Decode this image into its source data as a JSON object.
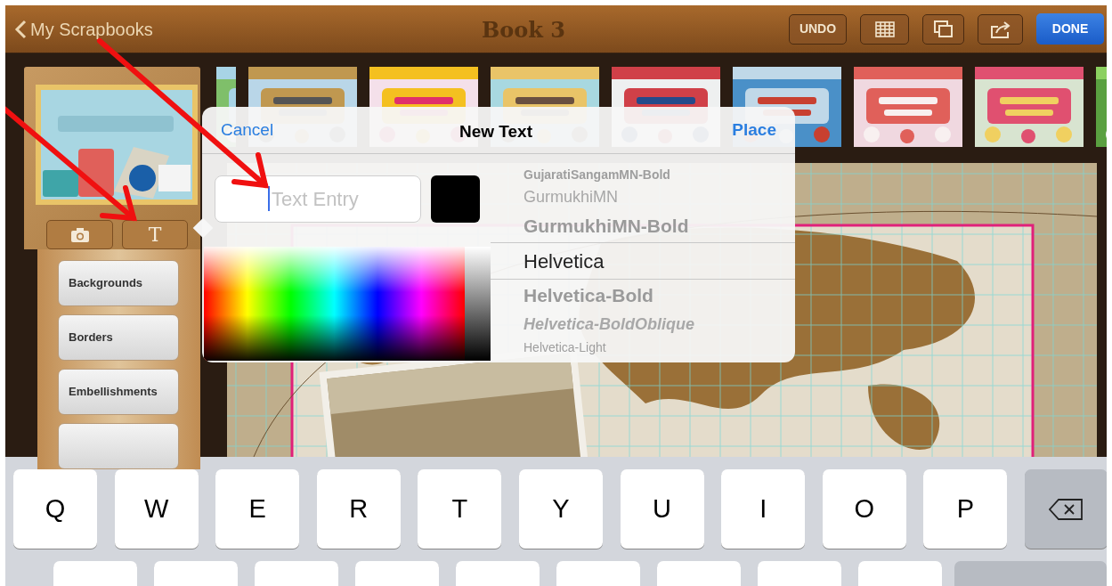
{
  "top_bar": {
    "back_label": "My Scrapbooks",
    "title": "Book 3",
    "undo_label": "UNDO",
    "done_label": "DONE"
  },
  "sidebar": {
    "text_button_label": "T",
    "tool_buttons": [
      {
        "label": "Backgrounds"
      },
      {
        "label": "Borders"
      },
      {
        "label": "Embellishments"
      }
    ]
  },
  "popover": {
    "cancel_label": "Cancel",
    "title": "New Text",
    "place_label": "Place",
    "text_field": {
      "placeholder": "Text Entry",
      "focused": true
    },
    "color_swatch": {
      "color": "#000000"
    },
    "fonts": [
      {
        "label": "GujaratiSangamMN-Bold",
        "kind": "bold",
        "selected": false
      },
      {
        "label": "GurmukhiMN",
        "kind": "regular",
        "selected": false
      },
      {
        "label": "GurmukhiMN-Bold",
        "kind": "bold",
        "selected": false
      },
      {
        "label": "Helvetica",
        "kind": "regular",
        "selected": true
      },
      {
        "label": "Helvetica-Bold",
        "kind": "bold",
        "selected": false
      },
      {
        "label": "Helvetica-BoldOblique",
        "kind": "bolditalic",
        "selected": false
      },
      {
        "label": "Helvetica-Light",
        "kind": "regular",
        "selected": false
      }
    ]
  },
  "keyboard": {
    "rows": [
      [
        {
          "kind": "letter",
          "label": "Q"
        },
        {
          "kind": "letter",
          "label": "W"
        },
        {
          "kind": "letter",
          "label": "E"
        },
        {
          "kind": "letter",
          "label": "R"
        },
        {
          "kind": "letter",
          "label": "T"
        },
        {
          "kind": "letter",
          "label": "Y"
        },
        {
          "kind": "letter",
          "label": "U"
        },
        {
          "kind": "letter",
          "label": "I"
        },
        {
          "kind": "letter",
          "label": "O"
        },
        {
          "kind": "letter",
          "label": "P"
        },
        {
          "kind": "delete"
        }
      ],
      [
        {
          "kind": "letter"
        },
        {
          "kind": "letter"
        },
        {
          "kind": "letter"
        },
        {
          "kind": "letter"
        },
        {
          "kind": "letter"
        },
        {
          "kind": "letter"
        },
        {
          "kind": "letter"
        },
        {
          "kind": "letter"
        },
        {
          "kind": "letter"
        },
        {
          "kind": "return"
        }
      ]
    ]
  }
}
